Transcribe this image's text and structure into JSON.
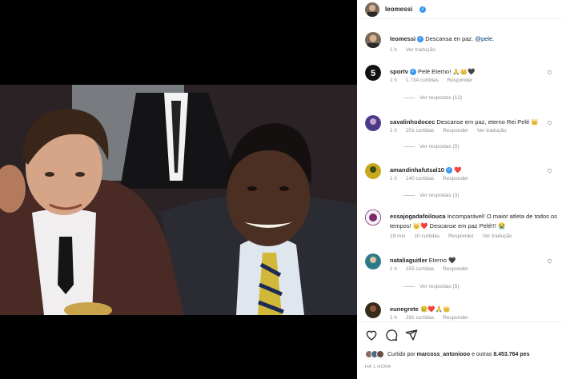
{
  "post": {
    "username": "leomessi",
    "verified_mark": "✓",
    "caption_text": "Descansa en paz.",
    "caption_mention": "@pele.",
    "caption_time": "1 h",
    "caption_translate": "Ver tradução"
  },
  "comments": [
    {
      "user": "sportv",
      "text": "Pelé Eterno! 🙏👑🖤",
      "time": "1 h",
      "likes": "1.734 curtidas",
      "reply": "Responder",
      "translate": "",
      "view_replies": "Ver respostas (12)",
      "avatar_color": "#111111"
    },
    {
      "user": "cavalinhodocec",
      "text": "Descanse em paz, eterno Rei Pelé 👑",
      "time": "1 h",
      "likes": "201 curtidas",
      "reply": "Responder",
      "translate": "Ver tradução",
      "view_replies": "Ver respostas (5)",
      "avatar_color": "#4a3a8a"
    },
    {
      "user": "amandinhafutsal10",
      "text": "❤️",
      "time": "1 h",
      "likes": "140 curtidas",
      "reply": "Responder",
      "translate": "",
      "view_replies": "Ver respostas (3)",
      "avatar_color": "#c8a81c"
    },
    {
      "user": "essajogadafoilouca",
      "text": "Incomparável! O maior atleta de todos os",
      "text2": "tempos! 👑❤️ Descanse em paz Pelé!!! 😭",
      "time": "19 min",
      "likes": "10 curtidas",
      "reply": "Responder",
      "translate": "Ver tradução",
      "view_replies": "",
      "avatar_color": "#7a2a6a"
    },
    {
      "user": "nataliaguitler",
      "text": "Eterno 🖤",
      "time": "1 h",
      "likes": "255 curtidas",
      "reply": "Responder",
      "translate": "",
      "view_replies": "Ver respostas (5)",
      "avatar_color": "#2a7a8a"
    },
    {
      "user": "eunegrete",
      "text": "😢❤️🙏👑",
      "time": "1 h",
      "likes": "291 curtidas",
      "reply": "Responder",
      "translate": "",
      "view_replies": "",
      "avatar_color": "#3a2a1a"
    }
  ],
  "actions": {
    "like_icon": "heart-icon",
    "comment_icon": "comment-icon",
    "share_icon": "share-icon"
  },
  "likes_summary": {
    "prefix": "Curtido por",
    "user": "marcoss_antoniooo",
    "middle": "e outras",
    "count": "8.453.764",
    "suffix": "pes"
  },
  "post_time": "HÁ 1 HORA",
  "colors": {
    "link": "#00376b",
    "verified": "#3897f0",
    "muted": "#8e8e8e",
    "heart": "#ed4956"
  }
}
